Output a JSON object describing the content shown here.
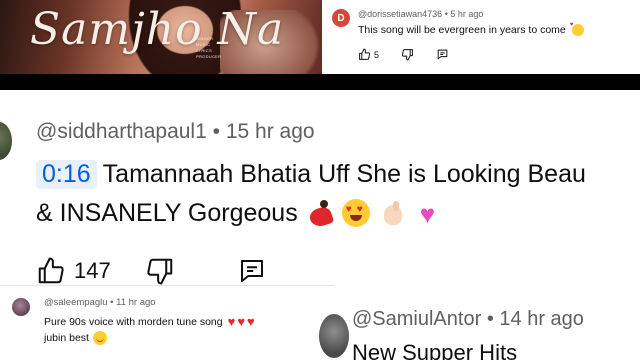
{
  "thumbnail": {
    "title": "Samjho Na",
    "credits": [
      "SINGER",
      "MUSIC",
      "LYRICS",
      "PRODUCER"
    ]
  },
  "comment_top": {
    "avatar_letter": "D",
    "avatar_color": "#d4473d",
    "author": "@dorissetiawan4736",
    "time": "5 hr ago",
    "text": "This song will be evergreen in years to come",
    "emoji": "smiling-face-with-hearts",
    "like_count": "5",
    "icons": [
      "thumbs-up-icon",
      "thumbs-down-icon",
      "reply-icon"
    ]
  },
  "comment_main": {
    "author": "@siddharthapaul1",
    "time": "15 hr ago",
    "timestamp": "0:16",
    "text_line1": "Tamannaah Bhatia Uff She is Looking Beau",
    "text_line2": "& INSANELY Gorgeous",
    "emojis": [
      "dancer",
      "heart-eyes",
      "pinching-hand",
      "sparkling-heart"
    ],
    "like_count": "147",
    "timestamp_color": "#065fd4"
  },
  "comment_bottom_left": {
    "author": "@saleempaglu",
    "time": "11 hr ago",
    "text_line1": "Pure 90s voice with morden tune song",
    "text_line2": "jubin best",
    "emojis": [
      "red-heart",
      "red-heart",
      "red-heart",
      "smiling-face"
    ]
  },
  "comment_bottom_right": {
    "author": "@SamiulAntor",
    "time": "14 hr ago",
    "text": "New Supper Hits"
  },
  "separator": "•",
  "colors": {
    "meta_gray": "#606060",
    "text": "#0f0f0f",
    "band": "#000000"
  }
}
